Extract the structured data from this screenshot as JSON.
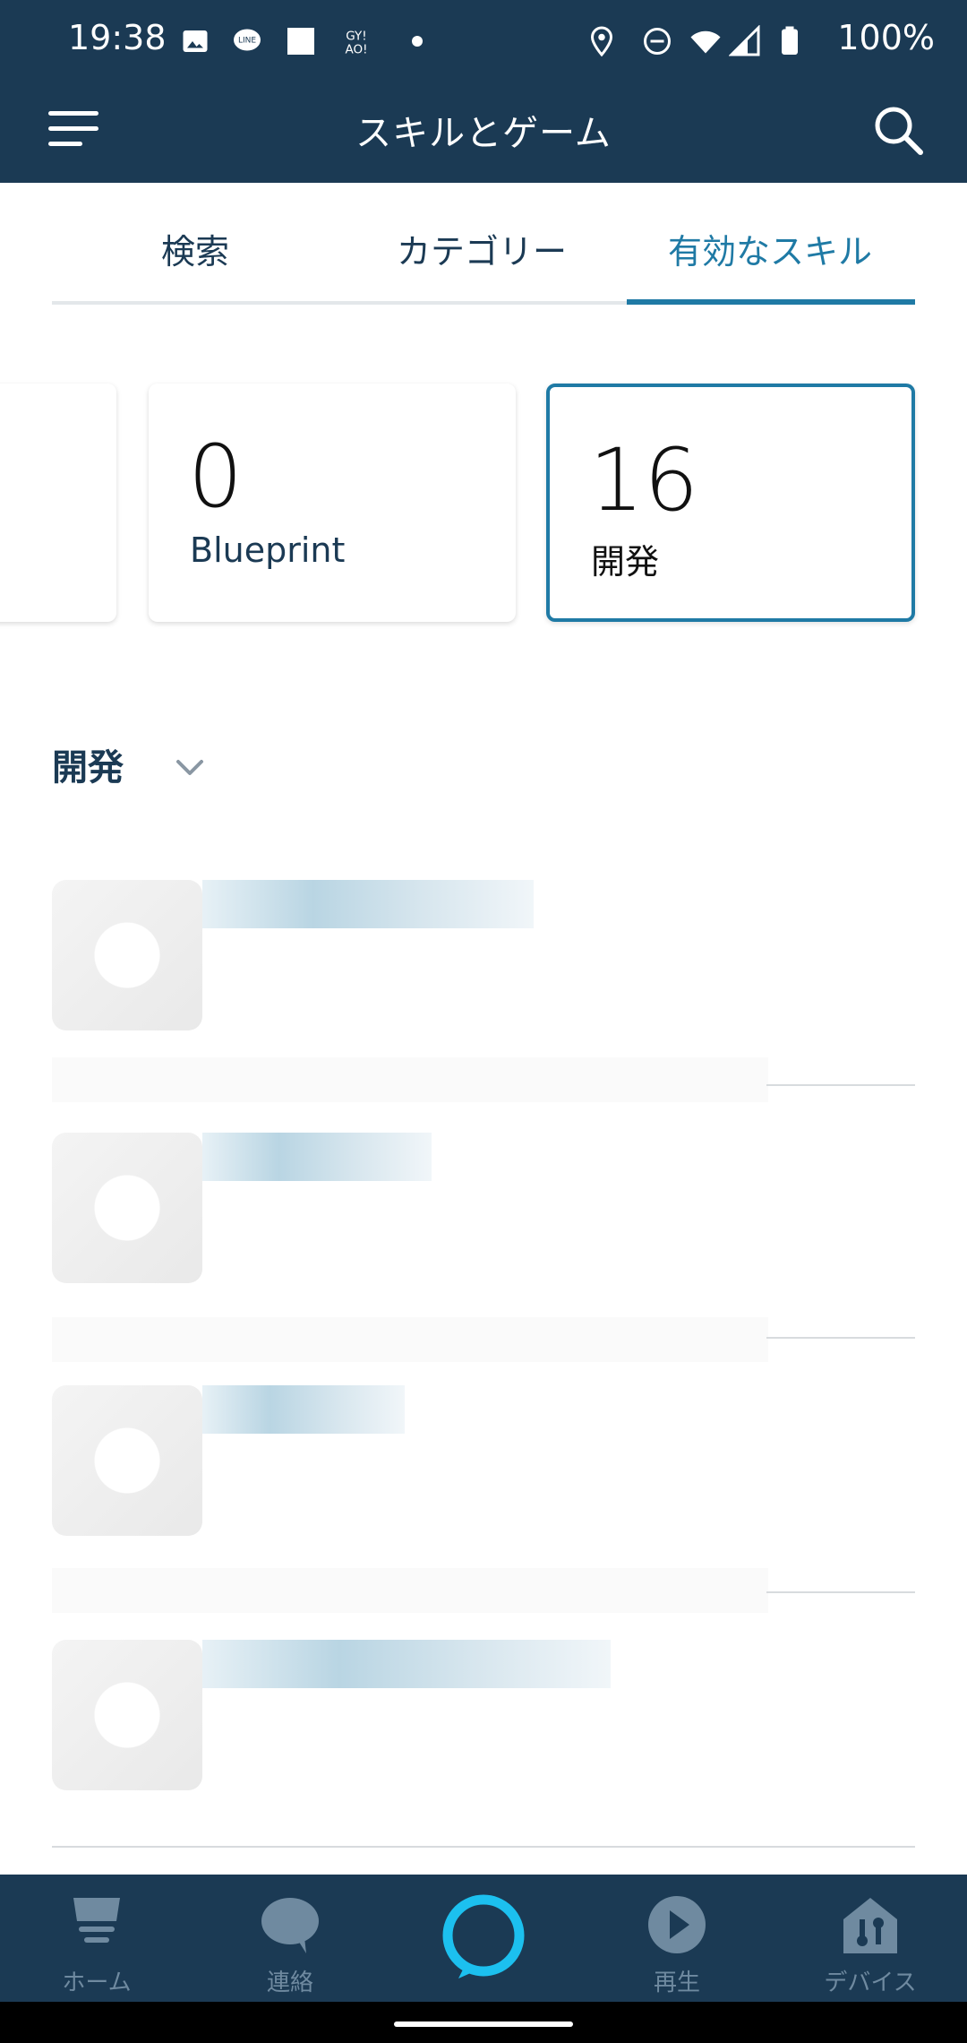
{
  "status_bar": {
    "time": "19:38",
    "battery_text": "100%"
  },
  "app_bar": {
    "title": "スキルとゲーム"
  },
  "tabs": [
    {
      "label": "検索"
    },
    {
      "label": "カテゴリー"
    },
    {
      "label": "有効なスキル",
      "active": true
    }
  ],
  "cards": [
    {
      "count": "0",
      "label": "Blueprint"
    },
    {
      "count": "16",
      "label": "開発",
      "selected": true
    }
  ],
  "section": {
    "title": "開発"
  },
  "skills_list_count_visible": 4,
  "bottom_nav": [
    {
      "label": "ホーム",
      "icon": "home-icon"
    },
    {
      "label": "連絡",
      "icon": "chat-icon"
    },
    {
      "label": "",
      "icon": "alexa-icon"
    },
    {
      "label": "再生",
      "icon": "play-icon"
    },
    {
      "label": "デバイス",
      "icon": "devices-icon"
    }
  ],
  "colors": {
    "header_bg": "#1b3a54",
    "accent": "#1f7aa5",
    "alexa": "#1cc0ef"
  }
}
